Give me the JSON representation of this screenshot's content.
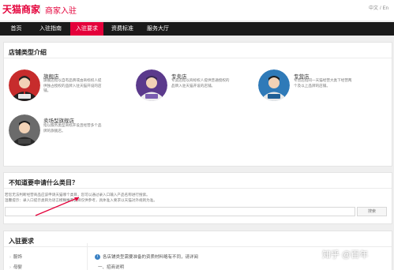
{
  "header": {
    "logo": "天猫商家",
    "subtitle": "商家入驻",
    "lang_cn": "中文",
    "lang_sep": "/",
    "lang_en": "En"
  },
  "nav": {
    "items": [
      {
        "label": "首页"
      },
      {
        "label": "入驻指南"
      },
      {
        "label": "入驻要求"
      },
      {
        "label": "资费标准"
      },
      {
        "label": "服务大厅"
      }
    ],
    "active_index": 2
  },
  "store_types": {
    "title": "店铺类型介绍",
    "stores": [
      {
        "name": "旗舰店",
        "badge": "旗舰店",
        "desc": "旗舰店指以自有品牌或由商标权人提供独占授权的品牌入驻天猫开设的店铺。"
      },
      {
        "name": "专卖店",
        "badge": "专卖店",
        "desc": "专卖店指以商标权人提供普通授权的品牌入驻天猫开设的店铺。"
      },
      {
        "name": "专营店",
        "badge": "专营店",
        "desc": "专营店指同一天猫经营大类下经营两个及以上品牌的店铺。"
      },
      {
        "name": "卖场型旗舰店",
        "badge": "卖场",
        "desc": "指以服务类型商标开设且经营多个品牌的旗舰店。"
      }
    ]
  },
  "category": {
    "title": "不知道要申请什么类目？",
    "line1": "若您无法判断经营商品应该申请天猫哪个类目，您可以通过录入口输入产品名称进行搜索。",
    "line2": "温馨提示：录入口提示类目为语言模糊推荐类目仅供参考，具体准入要求以天猫对外规则为准。",
    "search_button": "搜索"
  },
  "requirements": {
    "title": "入驻要求",
    "side_items": [
      "服饰",
      "母婴"
    ],
    "info": "各店铺类型需要准备的资质材料略有不同，请详阅",
    "step": "一、招商说明"
  },
  "watermark": "知乎 @百年",
  "colors": {
    "brand_red": "#e4003a",
    "nav_bg": "#1a1a1a"
  }
}
